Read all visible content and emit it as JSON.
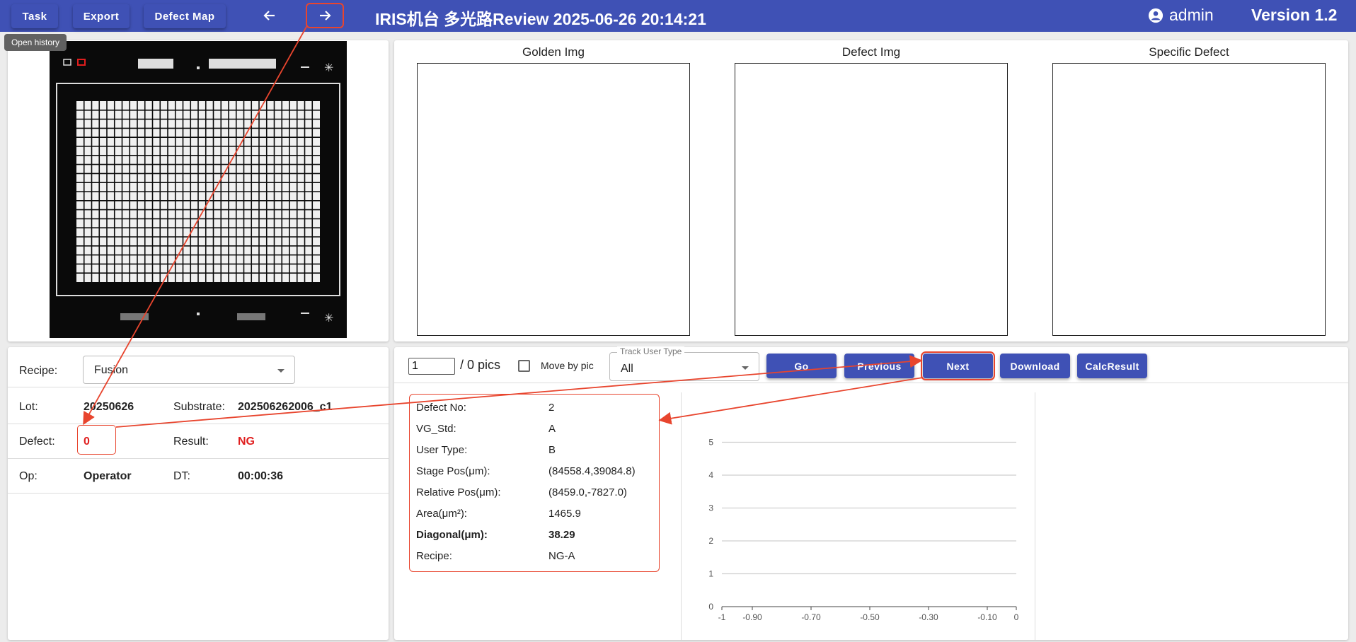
{
  "toolbar": {
    "task_label": "Task",
    "export_label": "Export",
    "defect_map_label": "Defect Map",
    "back_icon": "arrow-left-icon",
    "forward_icon": "arrow-right-icon",
    "tooltip": "Open history"
  },
  "header": {
    "title": "IRIS机台   多光路Review   2025-06-26 20:14:21",
    "user": "admin",
    "version": "Version 1.2"
  },
  "images": {
    "golden": "Golden Img",
    "defect": "Defect Img",
    "specific": "Specific Defect"
  },
  "info": {
    "recipe_label": "Recipe:",
    "recipe_value": "Fusion",
    "lot_label": "Lot:",
    "lot_value": "20250626",
    "substrate_label": "Substrate:",
    "substrate_value": "202506262006_c1",
    "defect_label": "Defect:",
    "defect_value": "0",
    "result_label": "Result:",
    "result_value": "NG",
    "op_label": "Op:",
    "op_value": "Operator",
    "dt_label": "DT:",
    "dt_value": "00:00:36"
  },
  "controls": {
    "page_value": "1",
    "total_text": "/ 0 pics",
    "move_by_pic_label": "Move by pic",
    "track_legend": "Track User Type",
    "track_value": "All",
    "go_label": "Go",
    "previous_label": "Previous",
    "next_label": "Next",
    "download_label": "Download",
    "calc_label": "CalcResult"
  },
  "defect_detail": [
    {
      "key": "Defect No:",
      "value": "2"
    },
    {
      "key": "VG_Std:",
      "value": "A"
    },
    {
      "key": "User Type:",
      "value": "B"
    },
    {
      "key": "Stage Pos(μm):",
      "value": "(84558.4,39084.8)"
    },
    {
      "key": "Relative Pos(μm):",
      "value": "(8459.0,-7827.0)"
    },
    {
      "key": "Area(μm²):",
      "value": "1465.9"
    },
    {
      "key": "Diagonal(μm):",
      "value": "38.29"
    },
    {
      "key": "Recipe:",
      "value": "NG-A"
    }
  ],
  "plot": {
    "y_ticks": [
      "0",
      "1",
      "2",
      "3",
      "4",
      "5"
    ],
    "x_ticks": [
      "-1",
      "-0.90",
      "-0.70",
      "-0.50",
      "-0.30",
      "-0.10",
      "0"
    ]
  },
  "colors": {
    "primary": "#3f51b5",
    "highlight": "#e8452e",
    "alert": "#e01e1e"
  }
}
